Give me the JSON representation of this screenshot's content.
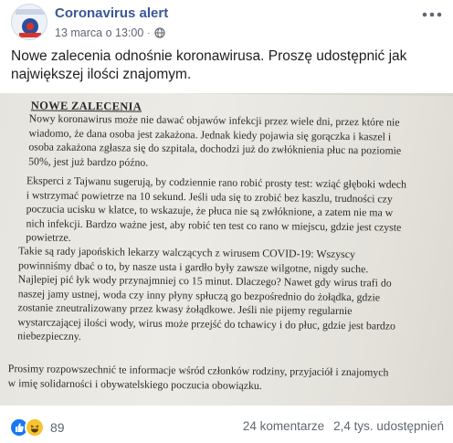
{
  "post": {
    "author": "Coronavirus alert",
    "timestamp": "13 marca o 13:00",
    "separator": "·",
    "privacy_icon": "globe-icon",
    "more_icon": "more-options-icon",
    "text": "Nowe zalecenia odnośnie koronawirusa. Proszę udostępnić jak największej ilości znajomym."
  },
  "photo": {
    "heading": "NOWE ZALECENIA",
    "paragraph1": "Nowy koronawirus może nie dawać objawów infekcji przez wiele dni, przez które nie\nwiadomo, że dana osoba jest zakażona. Jednak kiedy pojawia się gorączka i kaszel i\nosoba zakażona zgłasza się do szpitala, dochodzi już do zwłóknienia płuc na poziomie\n50%, jest już bardzo późno.",
    "paragraph2": "Eksperci z Tajwanu sugerują, by codziennie rano robić prosty test: wziąć głęboki wdech\ni wstrzymać powietrze na 10 sekund. Jeśli uda się to zrobić bez kaszlu, trudności czy\npoczucia ucisku w klatce, to wskazuje, że płuca nie są zwłóknione, a zatem nie ma w\nnich infekcji. Bardzo ważne jest, aby robić ten test co rano w miejscu, gdzie jest czyste\npowietrze.",
    "paragraph3": "Takie są rady japońskich lekarzy walczących z wirusem COVID-19: Wszyscy\npowinniśmy dbać o to, by nasze usta i gardło były zawsze wilgotne, nigdy suche.\nNajlepiej pić łyk wody przynajmniej co 15 minut. Dlaczego? Nawet gdy wirus trafi do\nnaszej jamy ustnej, woda czy inny płyny spłuczą go bezpośrednio do żołądka, gdzie\nzostanie zneutralizowany przez kwasy żołądkowe. Jeśli nie pijemy regularnie\nwystarczającej ilości wody, wirus może przejść do tchawicy i do płuc, gdzie jest bardzo\nniebezpieczny.",
    "paragraph4": "Prosimy rozpowszechnić te informacje wśród członków rodziny, przyjaciół i znajomych\nw imię solidarności i obywatelskiego poczucia obowiązku."
  },
  "footer": {
    "like_icon": "like-reaction-icon",
    "haha_icon": "haha-reaction-icon",
    "reaction_count": "89",
    "comments": "24 komentarze",
    "shares": "2,4 tys. udostępnień"
  }
}
